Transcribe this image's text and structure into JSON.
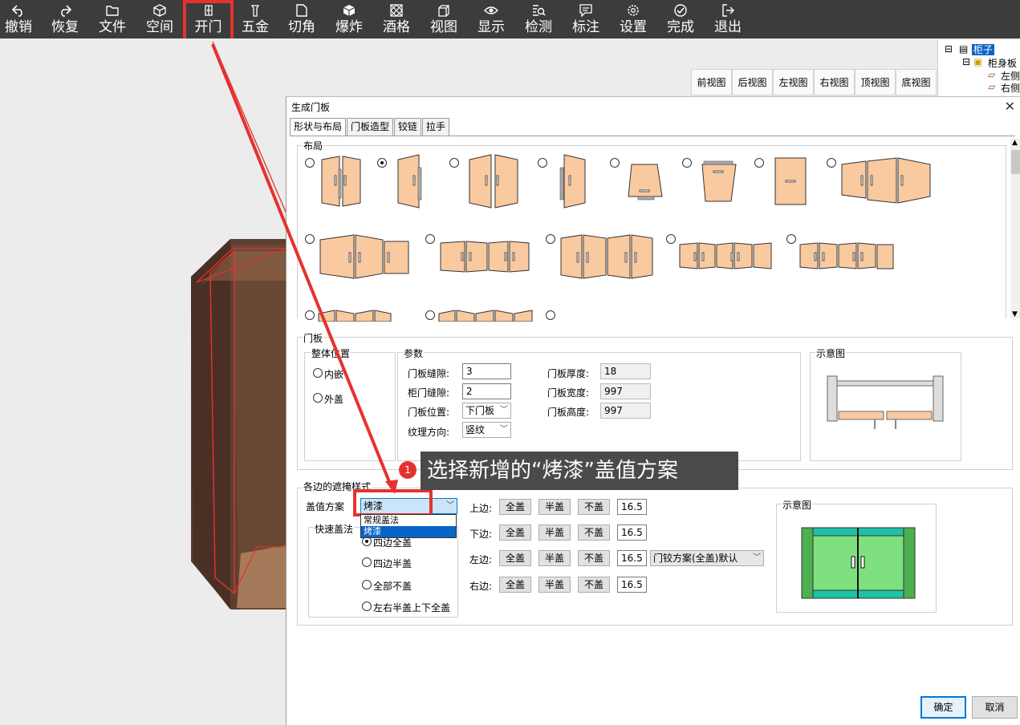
{
  "toolbar": {
    "items": [
      {
        "label": "撤销",
        "icon": "undo-icon"
      },
      {
        "label": "恢复",
        "icon": "redo-icon"
      },
      {
        "label": "文件",
        "icon": "folder-icon"
      },
      {
        "label": "空间",
        "icon": "cube-icon"
      },
      {
        "label": "开门",
        "icon": "door-icon"
      },
      {
        "label": "五金",
        "icon": "hardware-icon"
      },
      {
        "label": "切角",
        "icon": "cut-corner-icon"
      },
      {
        "label": "爆炸",
        "icon": "explode-icon"
      },
      {
        "label": "酒格",
        "icon": "wine-rack-icon"
      },
      {
        "label": "视图",
        "icon": "view-icon"
      },
      {
        "label": "显示",
        "icon": "eye-icon"
      },
      {
        "label": "检测",
        "icon": "check-icon"
      },
      {
        "label": "标注",
        "icon": "annotation-icon"
      },
      {
        "label": "设置",
        "icon": "gear-icon"
      },
      {
        "label": "完成",
        "icon": "done-icon"
      },
      {
        "label": "退出",
        "icon": "exit-icon"
      }
    ]
  },
  "tree": {
    "root": "柜子",
    "child": "柜身板",
    "leaf1": "左侧",
    "leaf2": "右侧"
  },
  "views": [
    "前视图",
    "后视图",
    "左视图",
    "右视图",
    "顶视图",
    "底视图"
  ],
  "dialog": {
    "title": "生成门板",
    "tabs": [
      "形状与布局",
      "门板造型",
      "铰链",
      "拉手"
    ],
    "layout_label": "布局",
    "door_panel_label": "门板",
    "position_group": "整体位置",
    "inner": "内嵌",
    "outer": "外盖",
    "params_group": "参数",
    "gap_label": "门板缝隙:",
    "gap_value": "3",
    "cabinet_gap_label": "柜门缝隙:",
    "cabinet_gap_value": "2",
    "door_pos_label": "门板位置:",
    "door_pos_value": "下门板",
    "grain_label": "纹理方向:",
    "grain_value": "竖纹",
    "thickness_label": "门板厚度:",
    "thickness_value": "18",
    "width_label": "门板宽度:",
    "width_value": "997",
    "height_label": "门板高度:",
    "height_value": "997",
    "diagram_label": "示意图",
    "cover_group": "各边的遮掩样式",
    "scheme_label": "盖值方案",
    "scheme_value": "烤漆",
    "scheme_options": [
      "常规盖法",
      "烤漆"
    ],
    "quick_label": "快速盖法",
    "quick_options": [
      "四边全盖",
      "四边半盖",
      "全部不盖",
      "左右半盖上下全盖"
    ],
    "edges": [
      {
        "label": "上边:",
        "value": "16.5"
      },
      {
        "label": "下边:",
        "value": "16.5"
      },
      {
        "label": "左边:",
        "value": "16.5"
      },
      {
        "label": "右边:",
        "value": "16.5"
      }
    ],
    "full_cover": "全盖",
    "half_cover": "半盖",
    "no_cover": "不盖",
    "hinge_scheme": "门铰方案(全盖)默认",
    "diagram2_label": "示意图",
    "ok": "确定",
    "cancel": "取消"
  },
  "callout": {
    "badge": "1",
    "text": "选择新增的“烤漆”盖值方案"
  },
  "colors": {
    "accent_red": "#e4332f",
    "door_fill": "#f9c9a0",
    "selection_blue": "#0a64c8"
  }
}
